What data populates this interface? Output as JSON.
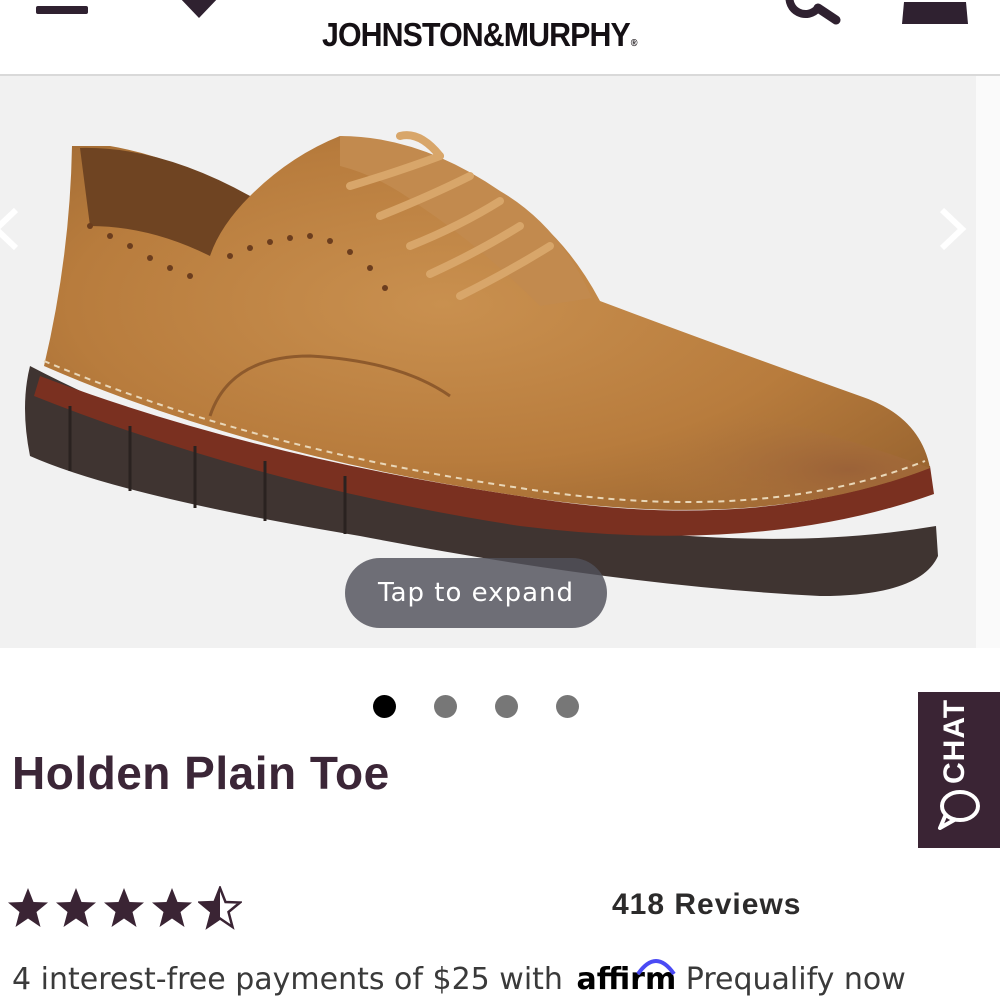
{
  "header": {
    "menu_icon": "hamburger-menu-icon",
    "store_icon": "location-pin-icon",
    "brand_name": "JOHNSTON&MURPHY",
    "brand_mark": "®",
    "search_icon": "search-icon",
    "bag_icon": "shopping-bag-icon"
  },
  "gallery": {
    "prev_icon": "chevron-left-icon",
    "next_icon": "chevron-right-icon",
    "expand_label": "Tap to expand",
    "dot_count": 4,
    "active_dot": 1
  },
  "product": {
    "title": "Holden Plain Toe",
    "rating": 4.5,
    "reviews_label": "418 Reviews"
  },
  "chat": {
    "label": "CHAT",
    "icon": "chat-bubble-icon"
  },
  "payments": {
    "text": "4 interest-free payments of $25 with ",
    "affirm_brand": "affirm",
    "prequalify": "Prequalify now"
  },
  "colors": {
    "brand_plum": "#3a2434",
    "star": "#3a2434",
    "header_border": "#d9d9d9"
  }
}
